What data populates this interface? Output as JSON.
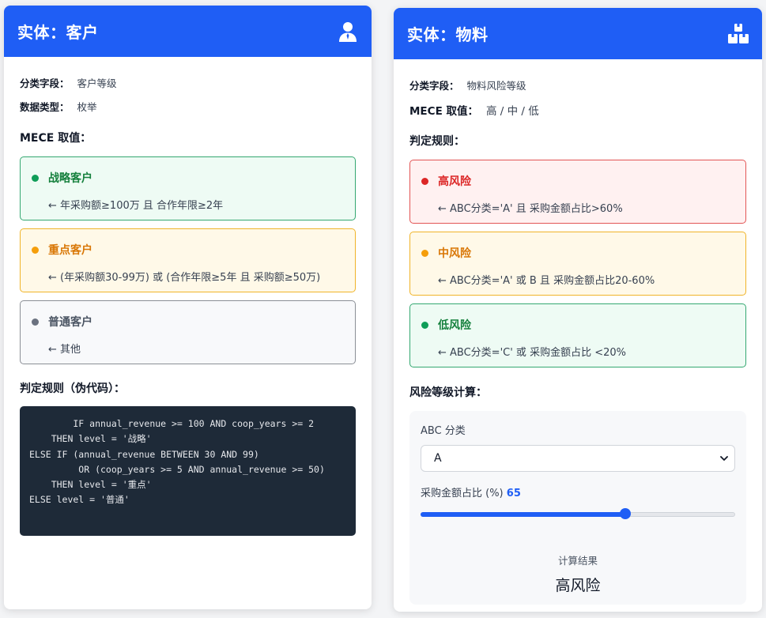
{
  "customer": {
    "title": "实体：客户",
    "icon": "user-icon",
    "field_label": "分类字段：",
    "field_value": "客户等级",
    "type_label": "数据类型：",
    "type_value": "枚举",
    "mece_title": "MECE 取值：",
    "options": [
      {
        "title": "战略客户",
        "rule": "← 年采购额≥100万 且 合作年限≥2年",
        "color": "#0f9d58"
      },
      {
        "title": "重点客户",
        "rule": "← (年采购额30-99万) 或 (合作年限≥5年 且 采购额≥50万)",
        "color": "#f59e0b"
      },
      {
        "title": "普通客户",
        "rule": "← 其他",
        "color": "#6b7280"
      }
    ],
    "rules_title": "判定规则（伪代码）：",
    "code": "        IF annual_revenue >= 100 AND coop_years >= 2\n    THEN level = '战略'\nELSE IF (annual_revenue BETWEEN 30 AND 99)\n         OR (coop_years >= 5 AND annual_revenue >= 50)\n    THEN level = '重点'\nELSE level = '普通'"
  },
  "material": {
    "title": "实体：物料",
    "icon": "boxes-icon",
    "field_label": "分类字段：",
    "field_value": "物料风险等级",
    "mece_label": "MECE 取值：",
    "mece_value": "高 / 中 / 低",
    "rules_title": "判定规则：",
    "options": [
      {
        "title": "高风险",
        "rule": "← ABC分类='A' 且 采购金额占比>60%",
        "color": "#dc2626"
      },
      {
        "title": "中风险",
        "rule": "← ABC分类='A' 或 B 且 采购金额占比20-60%",
        "color": "#f59e0b"
      },
      {
        "title": "低风险",
        "rule": "← ABC分类='C' 或 采购金额占比 <20%",
        "color": "#0f9d58"
      }
    ],
    "calc_title": "风险等级计算：",
    "calc": {
      "abc_label": "ABC 分类",
      "abc_value": "A",
      "ratio_label": "采购金额占比 (%)",
      "ratio_value": "65",
      "ratio_fraction": 0.65,
      "result_label": "计算结果",
      "result_value": "高风险"
    }
  },
  "colors": {
    "brand": "#1f5ef5"
  }
}
